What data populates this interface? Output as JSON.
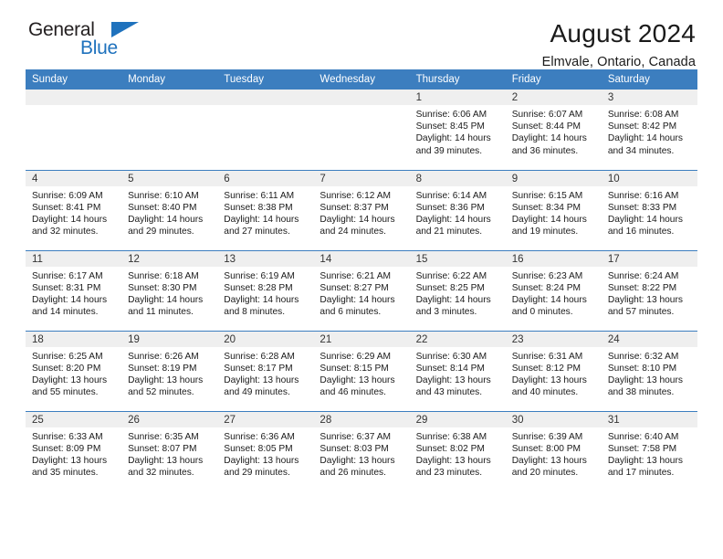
{
  "logo": {
    "word_top": "General",
    "word_bottom": "Blue",
    "triangle_color": "#1f72bd",
    "icon": "triangle-icon"
  },
  "header": {
    "title": "August 2024",
    "subtitle": "Elmvale, Ontario, Canada"
  },
  "theme": {
    "header_blue": "#3c7ebf",
    "daynum_gray": "#efefef",
    "text": "#1a1a1a"
  },
  "weekdays": [
    "Sunday",
    "Monday",
    "Tuesday",
    "Wednesday",
    "Thursday",
    "Friday",
    "Saturday"
  ],
  "weeks": [
    [
      {
        "day": "",
        "empty": true,
        "sunrise": "",
        "sunset": "",
        "daylight1": "",
        "daylight2": ""
      },
      {
        "day": "",
        "empty": true,
        "sunrise": "",
        "sunset": "",
        "daylight1": "",
        "daylight2": ""
      },
      {
        "day": "",
        "empty": true,
        "sunrise": "",
        "sunset": "",
        "daylight1": "",
        "daylight2": ""
      },
      {
        "day": "",
        "empty": true,
        "sunrise": "",
        "sunset": "",
        "daylight1": "",
        "daylight2": ""
      },
      {
        "day": "1",
        "sunrise": "Sunrise: 6:06 AM",
        "sunset": "Sunset: 8:45 PM",
        "daylight1": "Daylight: 14 hours",
        "daylight2": "and 39 minutes."
      },
      {
        "day": "2",
        "sunrise": "Sunrise: 6:07 AM",
        "sunset": "Sunset: 8:44 PM",
        "daylight1": "Daylight: 14 hours",
        "daylight2": "and 36 minutes."
      },
      {
        "day": "3",
        "sunrise": "Sunrise: 6:08 AM",
        "sunset": "Sunset: 8:42 PM",
        "daylight1": "Daylight: 14 hours",
        "daylight2": "and 34 minutes."
      }
    ],
    [
      {
        "day": "4",
        "sunrise": "Sunrise: 6:09 AM",
        "sunset": "Sunset: 8:41 PM",
        "daylight1": "Daylight: 14 hours",
        "daylight2": "and 32 minutes."
      },
      {
        "day": "5",
        "sunrise": "Sunrise: 6:10 AM",
        "sunset": "Sunset: 8:40 PM",
        "daylight1": "Daylight: 14 hours",
        "daylight2": "and 29 minutes."
      },
      {
        "day": "6",
        "sunrise": "Sunrise: 6:11 AM",
        "sunset": "Sunset: 8:38 PM",
        "daylight1": "Daylight: 14 hours",
        "daylight2": "and 27 minutes."
      },
      {
        "day": "7",
        "sunrise": "Sunrise: 6:12 AM",
        "sunset": "Sunset: 8:37 PM",
        "daylight1": "Daylight: 14 hours",
        "daylight2": "and 24 minutes."
      },
      {
        "day": "8",
        "sunrise": "Sunrise: 6:14 AM",
        "sunset": "Sunset: 8:36 PM",
        "daylight1": "Daylight: 14 hours",
        "daylight2": "and 21 minutes."
      },
      {
        "day": "9",
        "sunrise": "Sunrise: 6:15 AM",
        "sunset": "Sunset: 8:34 PM",
        "daylight1": "Daylight: 14 hours",
        "daylight2": "and 19 minutes."
      },
      {
        "day": "10",
        "sunrise": "Sunrise: 6:16 AM",
        "sunset": "Sunset: 8:33 PM",
        "daylight1": "Daylight: 14 hours",
        "daylight2": "and 16 minutes."
      }
    ],
    [
      {
        "day": "11",
        "sunrise": "Sunrise: 6:17 AM",
        "sunset": "Sunset: 8:31 PM",
        "daylight1": "Daylight: 14 hours",
        "daylight2": "and 14 minutes."
      },
      {
        "day": "12",
        "sunrise": "Sunrise: 6:18 AM",
        "sunset": "Sunset: 8:30 PM",
        "daylight1": "Daylight: 14 hours",
        "daylight2": "and 11 minutes."
      },
      {
        "day": "13",
        "sunrise": "Sunrise: 6:19 AM",
        "sunset": "Sunset: 8:28 PM",
        "daylight1": "Daylight: 14 hours",
        "daylight2": "and 8 minutes."
      },
      {
        "day": "14",
        "sunrise": "Sunrise: 6:21 AM",
        "sunset": "Sunset: 8:27 PM",
        "daylight1": "Daylight: 14 hours",
        "daylight2": "and 6 minutes."
      },
      {
        "day": "15",
        "sunrise": "Sunrise: 6:22 AM",
        "sunset": "Sunset: 8:25 PM",
        "daylight1": "Daylight: 14 hours",
        "daylight2": "and 3 minutes."
      },
      {
        "day": "16",
        "sunrise": "Sunrise: 6:23 AM",
        "sunset": "Sunset: 8:24 PM",
        "daylight1": "Daylight: 14 hours",
        "daylight2": "and 0 minutes."
      },
      {
        "day": "17",
        "sunrise": "Sunrise: 6:24 AM",
        "sunset": "Sunset: 8:22 PM",
        "daylight1": "Daylight: 13 hours",
        "daylight2": "and 57 minutes."
      }
    ],
    [
      {
        "day": "18",
        "sunrise": "Sunrise: 6:25 AM",
        "sunset": "Sunset: 8:20 PM",
        "daylight1": "Daylight: 13 hours",
        "daylight2": "and 55 minutes."
      },
      {
        "day": "19",
        "sunrise": "Sunrise: 6:26 AM",
        "sunset": "Sunset: 8:19 PM",
        "daylight1": "Daylight: 13 hours",
        "daylight2": "and 52 minutes."
      },
      {
        "day": "20",
        "sunrise": "Sunrise: 6:28 AM",
        "sunset": "Sunset: 8:17 PM",
        "daylight1": "Daylight: 13 hours",
        "daylight2": "and 49 minutes."
      },
      {
        "day": "21",
        "sunrise": "Sunrise: 6:29 AM",
        "sunset": "Sunset: 8:15 PM",
        "daylight1": "Daylight: 13 hours",
        "daylight2": "and 46 minutes."
      },
      {
        "day": "22",
        "sunrise": "Sunrise: 6:30 AM",
        "sunset": "Sunset: 8:14 PM",
        "daylight1": "Daylight: 13 hours",
        "daylight2": "and 43 minutes."
      },
      {
        "day": "23",
        "sunrise": "Sunrise: 6:31 AM",
        "sunset": "Sunset: 8:12 PM",
        "daylight1": "Daylight: 13 hours",
        "daylight2": "and 40 minutes."
      },
      {
        "day": "24",
        "sunrise": "Sunrise: 6:32 AM",
        "sunset": "Sunset: 8:10 PM",
        "daylight1": "Daylight: 13 hours",
        "daylight2": "and 38 minutes."
      }
    ],
    [
      {
        "day": "25",
        "sunrise": "Sunrise: 6:33 AM",
        "sunset": "Sunset: 8:09 PM",
        "daylight1": "Daylight: 13 hours",
        "daylight2": "and 35 minutes."
      },
      {
        "day": "26",
        "sunrise": "Sunrise: 6:35 AM",
        "sunset": "Sunset: 8:07 PM",
        "daylight1": "Daylight: 13 hours",
        "daylight2": "and 32 minutes."
      },
      {
        "day": "27",
        "sunrise": "Sunrise: 6:36 AM",
        "sunset": "Sunset: 8:05 PM",
        "daylight1": "Daylight: 13 hours",
        "daylight2": "and 29 minutes."
      },
      {
        "day": "28",
        "sunrise": "Sunrise: 6:37 AM",
        "sunset": "Sunset: 8:03 PM",
        "daylight1": "Daylight: 13 hours",
        "daylight2": "and 26 minutes."
      },
      {
        "day": "29",
        "sunrise": "Sunrise: 6:38 AM",
        "sunset": "Sunset: 8:02 PM",
        "daylight1": "Daylight: 13 hours",
        "daylight2": "and 23 minutes."
      },
      {
        "day": "30",
        "sunrise": "Sunrise: 6:39 AM",
        "sunset": "Sunset: 8:00 PM",
        "daylight1": "Daylight: 13 hours",
        "daylight2": "and 20 minutes."
      },
      {
        "day": "31",
        "sunrise": "Sunrise: 6:40 AM",
        "sunset": "Sunset: 7:58 PM",
        "daylight1": "Daylight: 13 hours",
        "daylight2": "and 17 minutes."
      }
    ]
  ]
}
